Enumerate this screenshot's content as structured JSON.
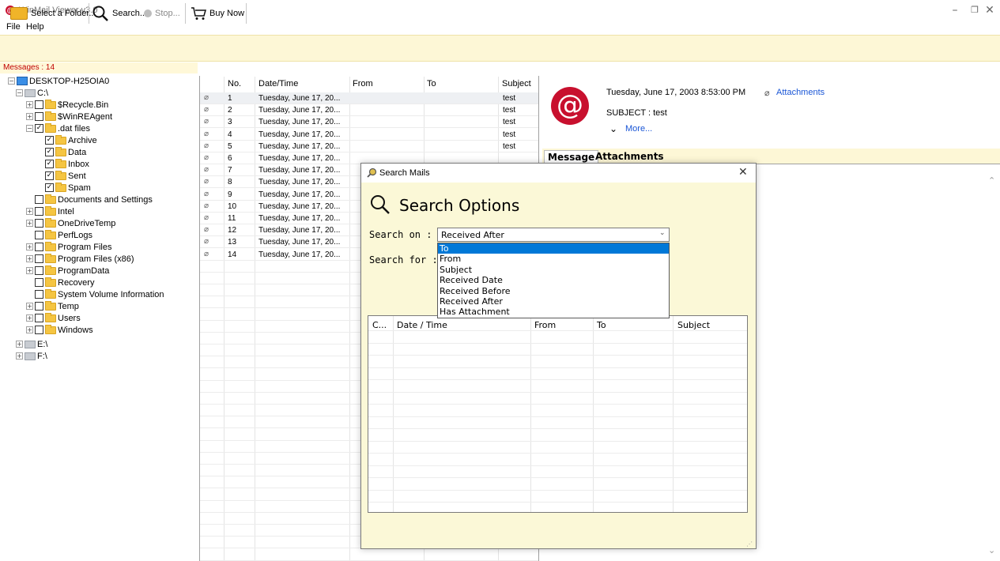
{
  "window": {
    "title": "WinMail Viewer v3.0",
    "minimize": "–",
    "restore": "❐",
    "close": "✕"
  },
  "menu": [
    {
      "label": "File"
    },
    {
      "label": "Help"
    }
  ],
  "toolbar": {
    "select_folder": "Select a Folder...",
    "search": "Search...",
    "stop": "Stop...",
    "buy_now": "Buy Now"
  },
  "status": {
    "messages": "Messages : 14"
  },
  "tree": {
    "root": "DESKTOP-H25OIA0",
    "c_drive": "C:\\",
    "items": [
      {
        "label": "$Recycle.Bin"
      },
      {
        "label": "$WinREAgent"
      },
      {
        "label": ".dat files"
      },
      {
        "label": "Archive"
      },
      {
        "label": "Data"
      },
      {
        "label": "Inbox"
      },
      {
        "label": "Sent"
      },
      {
        "label": "Spam"
      },
      {
        "label": "Documents and Settings"
      },
      {
        "label": "Intel"
      },
      {
        "label": "OneDriveTemp"
      },
      {
        "label": "PerfLogs"
      },
      {
        "label": "Program Files"
      },
      {
        "label": "Program Files (x86)"
      },
      {
        "label": "ProgramData"
      },
      {
        "label": "Recovery"
      },
      {
        "label": "System Volume Information"
      },
      {
        "label": "Temp"
      },
      {
        "label": "Users"
      },
      {
        "label": "Windows"
      }
    ],
    "e_drive": "E:\\",
    "f_drive": "F:\\"
  },
  "list": {
    "headers": {
      "no": "No.",
      "datetime": "Date/Time",
      "from": "From",
      "to": "To",
      "subject": "Subject"
    },
    "rows": [
      {
        "no": "1",
        "date": "Tuesday, June 17, 20...",
        "subject": "test"
      },
      {
        "no": "2",
        "date": "Tuesday, June 17, 20...",
        "subject": "test"
      },
      {
        "no": "3",
        "date": "Tuesday, June 17, 20...",
        "subject": "test"
      },
      {
        "no": "4",
        "date": "Tuesday, June 17, 20...",
        "subject": "test"
      },
      {
        "no": "5",
        "date": "Tuesday, June 17, 20...",
        "subject": "test"
      },
      {
        "no": "6",
        "date": "Tuesday, June 17, 20...",
        "subject": ""
      },
      {
        "no": "7",
        "date": "Tuesday, June 17, 20...",
        "subject": ""
      },
      {
        "no": "8",
        "date": "Tuesday, June 17, 20...",
        "subject": ""
      },
      {
        "no": "9",
        "date": "Tuesday, June 17, 20...",
        "subject": ""
      },
      {
        "no": "10",
        "date": "Tuesday, June 17, 20...",
        "subject": ""
      },
      {
        "no": "11",
        "date": "Tuesday, June 17, 20...",
        "subject": ""
      },
      {
        "no": "12",
        "date": "Tuesday, June 17, 20...",
        "subject": ""
      },
      {
        "no": "13",
        "date": "Tuesday, June 17, 20...",
        "subject": ""
      },
      {
        "no": "14",
        "date": "Tuesday, June 17, 20...",
        "subject": ""
      }
    ]
  },
  "preview": {
    "datetime": "Tuesday, June 17, 2003 8:53:00 PM",
    "attachments_link": "Attachments",
    "subject": "SUBJECT : test",
    "more": "More...",
    "tabs": [
      {
        "label": "Message"
      },
      {
        "label": "Attachments"
      }
    ]
  },
  "dialog": {
    "title": "Search Mails",
    "heading": "Search Options",
    "search_on_label": "Search on :",
    "search_for_label": "Search for :",
    "selected": "Received After",
    "options": [
      "To",
      "From",
      "Subject",
      "Received Date",
      "Received Before",
      "Received After",
      "Has Attachment"
    ],
    "highlighted": "To",
    "result_headers": {
      "c": "C...",
      "date": "Date / Time",
      "from": "From",
      "to": "To",
      "subject": "Subject"
    }
  },
  "colors": {
    "toolbar_bg": "#fdf7d6",
    "accent_red": "#c8102e",
    "selection_blue": "#0078d7",
    "link_blue": "#1a56d6"
  }
}
